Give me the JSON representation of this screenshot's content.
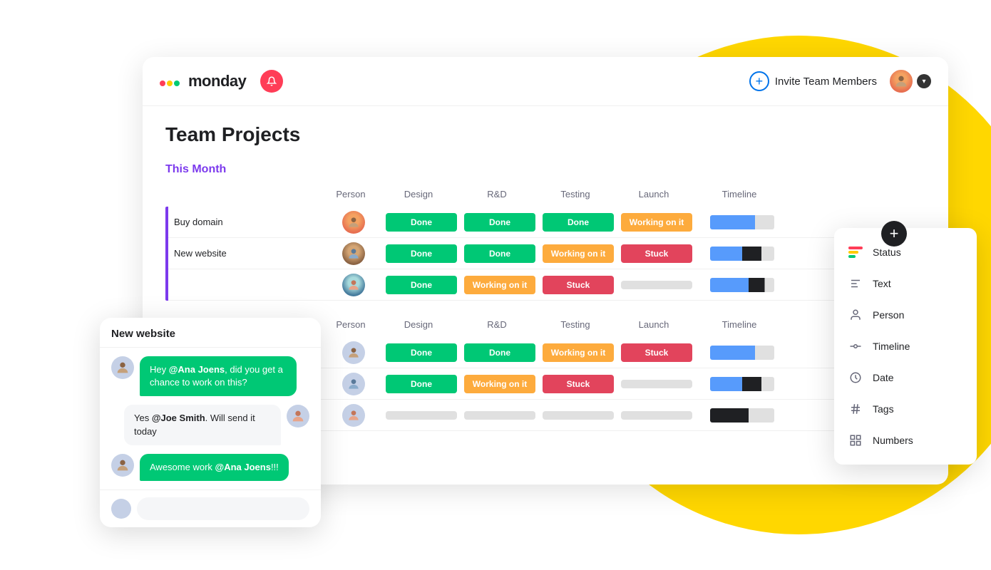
{
  "background": {
    "circle_color": "#FFD700"
  },
  "header": {
    "logo_text": "monday",
    "logo_dots": [
      "#ff3d57",
      "#ffcb00",
      "#00ca72"
    ],
    "invite_button_label": "Invite Team Members",
    "invite_plus_symbol": "+"
  },
  "board": {
    "title": "Team Projects",
    "this_month_label": "This Month",
    "table_headers": [
      "",
      "Person",
      "Design",
      "R&D",
      "Testing",
      "Launch",
      "Timeline"
    ],
    "rows_section1": [
      {
        "name": "Buy domain",
        "avatar": "man1",
        "design": "Done",
        "design_status": "done",
        "rd": "Done",
        "rd_status": "done",
        "testing": "Done",
        "testing_status": "done",
        "launch": "Working on it",
        "launch_status": "working",
        "timeline_type": 1
      },
      {
        "name": "New website",
        "avatar": "man2",
        "design": "Done",
        "design_status": "done",
        "rd": "Done",
        "rd_status": "done",
        "testing": "Working on it",
        "testing_status": "working",
        "launch": "Stuck",
        "launch_status": "stuck",
        "timeline_type": 2
      },
      {
        "name": "",
        "avatar": "woman1",
        "design": "Done",
        "design_status": "done",
        "rd": "Working on it",
        "rd_status": "working",
        "testing": "Stuck",
        "testing_status": "stuck",
        "launch": "",
        "launch_status": "empty",
        "timeline_type": 3
      }
    ],
    "rows_section2": [
      {
        "name": "",
        "avatar": "man1",
        "design": "Done",
        "design_status": "done",
        "rd": "Done",
        "rd_status": "done",
        "testing": "Working on it",
        "testing_status": "working",
        "launch": "Stuck",
        "launch_status": "stuck",
        "timeline_type": 1
      },
      {
        "name": "",
        "avatar": "man2",
        "design": "Done",
        "design_status": "done",
        "rd": "Working on it",
        "rd_status": "working",
        "testing": "Stuck",
        "testing_status": "stuck",
        "launch": "",
        "launch_status": "empty",
        "timeline_type": 2
      },
      {
        "name": "",
        "avatar": "woman1",
        "design": "",
        "design_status": "empty",
        "rd": "",
        "rd_status": "empty",
        "testing": "",
        "testing_status": "empty",
        "launch": "",
        "launch_status": "empty",
        "timeline_type": 4
      }
    ]
  },
  "column_menu": {
    "add_button": "+",
    "items": [
      {
        "id": "status",
        "label": "Status",
        "icon": "bars"
      },
      {
        "id": "text",
        "label": "Text",
        "icon": "text"
      },
      {
        "id": "person",
        "label": "Person",
        "icon": "person"
      },
      {
        "id": "timeline",
        "label": "Timeline",
        "icon": "timeline"
      },
      {
        "id": "date",
        "label": "Date",
        "icon": "date"
      },
      {
        "id": "tags",
        "label": "Tags",
        "icon": "hash"
      },
      {
        "id": "numbers",
        "label": "Numbers",
        "icon": "grid"
      }
    ]
  },
  "chat": {
    "title": "New website",
    "messages": [
      {
        "side": "left",
        "avatar": "man2",
        "text_prefix": "Hey ",
        "mention": "@Ana Joens",
        "text_suffix": ", did you get a chance to work on this?",
        "bubble_type": "green"
      },
      {
        "side": "right",
        "avatar": "woman1",
        "text_prefix": "Yes ",
        "mention": "@Joe Smith",
        "text_suffix": ". Will send it today",
        "bubble_type": "white"
      },
      {
        "side": "left",
        "avatar": "man2",
        "text_prefix": "Awesome work ",
        "mention": "@Ana Joens",
        "text_suffix": "!!!",
        "bubble_type": "green"
      }
    ]
  }
}
